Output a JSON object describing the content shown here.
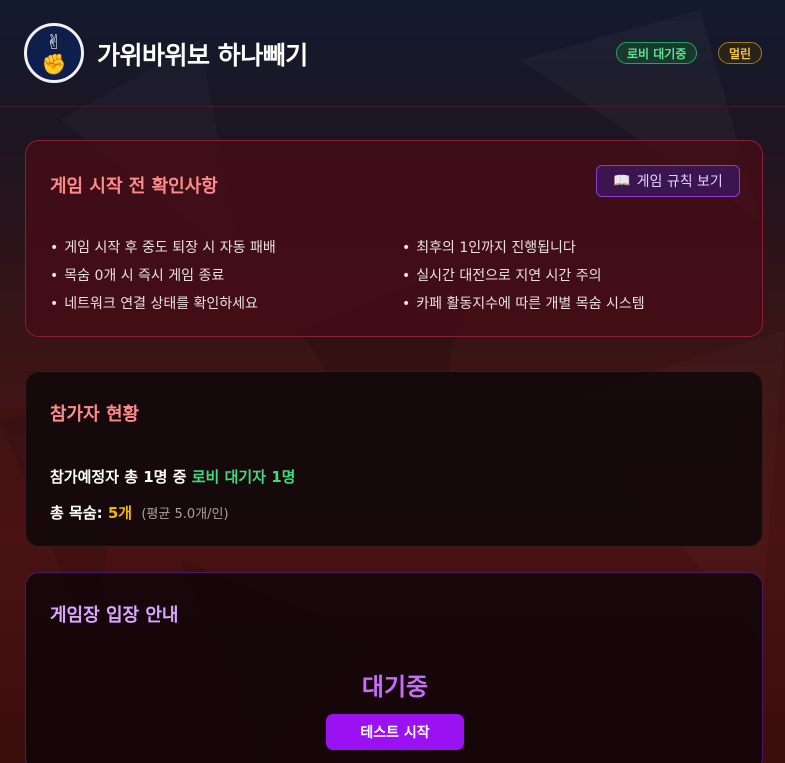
{
  "header": {
    "title": "가위바위보 하나빼기",
    "logo_icons": [
      "✌",
      "✊"
    ],
    "badge_lobby": "로비 대기중",
    "badge_user": "멀린"
  },
  "rules": {
    "title": "게임 시작 전 확인사항",
    "button_icon": "📖",
    "button_label": "게임 규칙 보기",
    "left_items": [
      "게임 시작 후 중도 퇴장 시 자동 패배",
      "목숨 0개 시 즉시 게임 종료",
      "네트워크 연결 상태를 확인하세요"
    ],
    "right_items": [
      "최후의 1인까지 진행됩니다",
      "실시간 대전으로 지연 시간 주의",
      "카페 활동지수에 따른 개별 목숨 시스템"
    ]
  },
  "participants": {
    "title": "참가자 현황",
    "line1_prefix": "참가예정자 총 1명 중",
    "line1_highlight": "로비 대기자 1명",
    "line2_prefix": "총 목숨:",
    "line2_value": "5개",
    "line2_avg": "(평균 5.0개/인)"
  },
  "entry": {
    "title": "게임장 입장 안내",
    "status": "대기중",
    "start_button": "테스트 시작"
  },
  "colors": {
    "accent_purple": "#9b12f2",
    "lobby_green": "#3ddc7a",
    "lives_gold": "#f4b400"
  }
}
